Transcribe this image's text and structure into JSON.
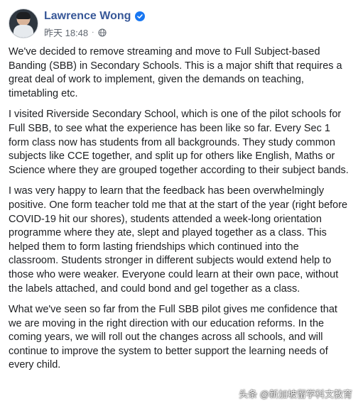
{
  "author": {
    "name": "Lawrence Wong",
    "verified_icon": "verified-badge-icon",
    "timestamp": "昨天 18:48",
    "audience_icon": "globe-icon"
  },
  "post": {
    "paragraphs": [
      "We've decided to remove streaming and move to Full Subject-based Banding (SBB) in Secondary Schools. This is a major shift that requires a great deal of work to implement, given the demands on teaching, timetabling etc.",
      "I visited Riverside Secondary School, which is one of the pilot schools for Full SBB, to see what the experience has been like so far. Every Sec 1 form class now has students from all backgrounds. They study common subjects like CCE together, and split up for others like English, Maths or Science where they are grouped together according to their subject bands.",
      "I was very happy to learn that the feedback has been overwhelmingly positive. One form teacher told me that at the start of the year (right before COVID-19 hit our shores), students attended a week-long orientation programme where they ate, slept and played together as a class. This helped them to form lasting friendships which continued into the classroom. Students stronger in different subjects would extend help to those who were weaker. Everyone could learn at their own pace, without the labels attached, and could bond and gel together as a class.",
      "What we've seen so far from the Full SBB pilot gives me confidence that we are moving in the right direction with our education reforms. In the coming years, we will roll out the changes across all schools, and will continue to improve the system to better support the learning needs of every child."
    ]
  },
  "watermark": "头条 @新加坡留学科文教育",
  "colors": {
    "name": "#385898",
    "verified": "#1877f2",
    "meta": "#606770",
    "text": "#1c1e21"
  }
}
